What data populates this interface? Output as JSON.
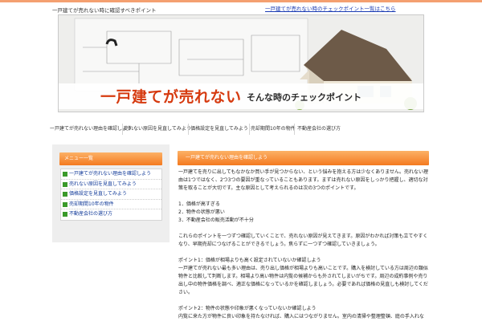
{
  "header": {
    "site_description": "一戸建てが売れない時に確認すべきポイント",
    "top_link": "一戸建てが売れない時のチェックポイント一覧はこちら"
  },
  "banner": {
    "title": "一戸建てが売れない",
    "subtitle": "そんな時のチェックポイント"
  },
  "nav": {
    "items": [
      "一戸建てが売れない理由を確認しよう",
      "売れない原因を見直してみよう",
      "価格設定を見直してみよう",
      "売却期間10年の物件",
      "不動産会社の選び方"
    ]
  },
  "sidebar": {
    "heading": "メニュー一覧",
    "items": [
      "一戸建てが売れない理由を確認しよう",
      "売れない原因を見直してみよう",
      "価格設定を見直してみよう",
      "売却期間10年の物件",
      "不動産会社の選び方"
    ]
  },
  "main": {
    "heading": "一戸建てが売れない理由を確認しよう",
    "intro": "一戸建てを売りに出してもなかなか買い手が見つからない、という悩みを抱える方は少なくありません。売れない理由は1つではなく、2つ3つの要因が重なっていることもあります。まずは売れない原因をしっかり把握し、適切な対策を取ることが大切です。主な原因として考えられるのは次の3つのポイントです。",
    "list": [
      "1．価格が高すぎる",
      "2．物件の状態が悪い",
      "3．不動産会社の販売活動が不十分"
    ],
    "para2": "これらのポイントを一つずつ確認していくことで、売れない原因が見えてきます。原因がわかれば対策も立てやすくなり、早期売却につなげることができるでしょう。焦らずに一つずつ確認していきましょう。",
    "section1_title": "ポイント1：価格が相場よりも高く設定されていないか確認しよう",
    "section1_text": "一戸建てが売れない最も多い理由は、売り出し価格が相場よりも高いことです。購入を検討している方は周辺の類似物件と比較して判断します。相場より高い物件は内覧の候補からも外されてしまいがちです。周辺の成約事例や売り出し中の物件価格を調べ、適正な価格になっているかを確認しましょう。必要であれば価格の見直しも検討してください。",
    "section2_title": "ポイント2：物件の状態や印象が悪くなっていないか確認しよう",
    "section2_text": "内覧に来た方が物件に良い印象を持たなければ、購入にはつながりません。室内の清掃や整理整頓、庭の手入れなど、第一印象を良くする工夫が大切です。また、設備の不具合や傷みがある場合は、Aの修繕を行うかどうかを検討しましょう。状態を改善すれば、Aの評価も上がり成約につながる可能性が高まります。"
  }
}
